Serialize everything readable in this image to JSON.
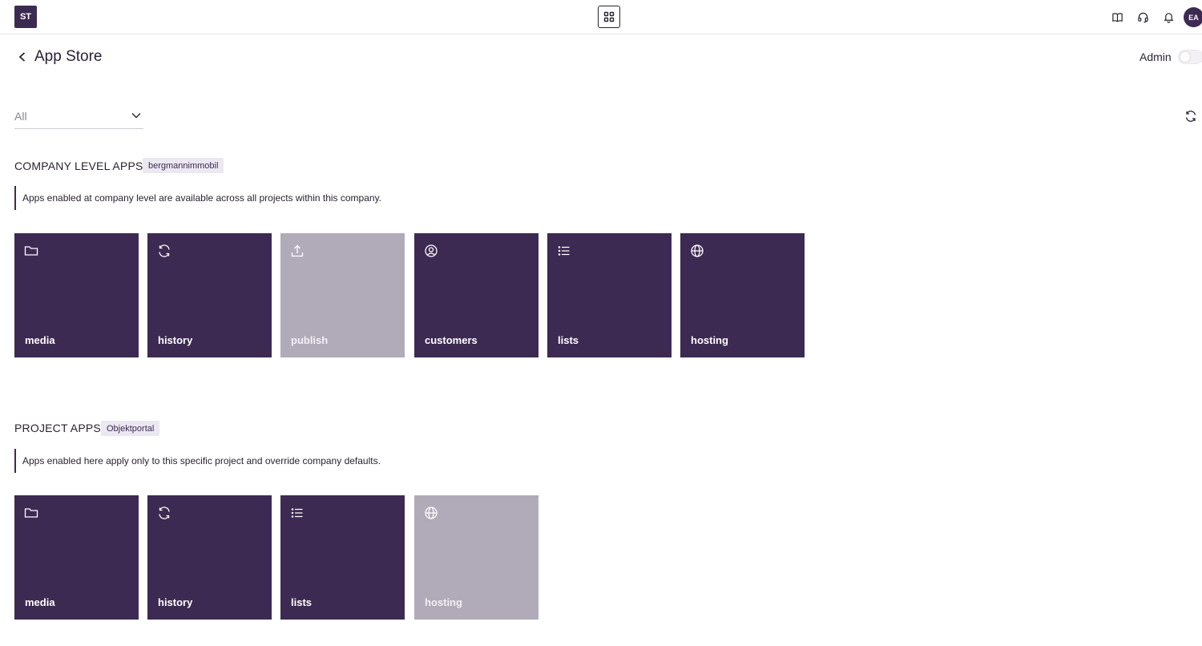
{
  "topbar": {
    "logo_text": "ST",
    "apps_icon": "grid-icon",
    "icons": [
      "book-icon",
      "headset-icon",
      "bell-icon"
    ],
    "avatar_initials": "EA"
  },
  "header": {
    "title": "App Store",
    "admin_label": "Admin",
    "admin_enabled": false
  },
  "filter": {
    "selected": "All"
  },
  "company_section": {
    "title": "COMPANY LEVEL APPS",
    "badge": "bergmannimmobil",
    "note": "Apps enabled at company level are available across all projects within this company.",
    "apps": [
      {
        "label": "media",
        "icon": "folder-icon",
        "enabled": true
      },
      {
        "label": "history",
        "icon": "refresh-icon",
        "enabled": true
      },
      {
        "label": "publish",
        "icon": "upload-icon",
        "enabled": false
      },
      {
        "label": "customers",
        "icon": "user-circle-icon",
        "enabled": true
      },
      {
        "label": "lists",
        "icon": "list-icon",
        "enabled": true
      },
      {
        "label": "hosting",
        "icon": "globe-icon",
        "enabled": true
      }
    ]
  },
  "project_section": {
    "title": "PROJECT APPS",
    "badge": "Objektportal",
    "note": "Apps enabled here apply only to this specific project and override company defaults.",
    "apps": [
      {
        "label": "media",
        "icon": "folder-icon",
        "enabled": true
      },
      {
        "label": "history",
        "icon": "refresh-icon",
        "enabled": true
      },
      {
        "label": "lists",
        "icon": "list-icon",
        "enabled": true
      },
      {
        "label": "hosting",
        "icon": "globe-icon",
        "enabled": false
      }
    ]
  },
  "colors": {
    "primary": "#3d2a52",
    "disabled_tile": "#b1aab9",
    "badge_bg": "#ece8f1"
  }
}
